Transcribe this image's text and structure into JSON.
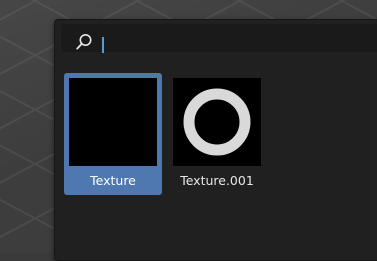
{
  "search": {
    "value": "",
    "icon": "search-icon"
  },
  "items": [
    {
      "label": "Texture",
      "selected": true,
      "preview": "empty-black"
    },
    {
      "label": "Texture.001",
      "selected": false,
      "preview": "white-ring"
    }
  ],
  "colors": {
    "selection": "#4f78b0",
    "caret": "#5b9bd5",
    "popup_background": "#202020"
  }
}
